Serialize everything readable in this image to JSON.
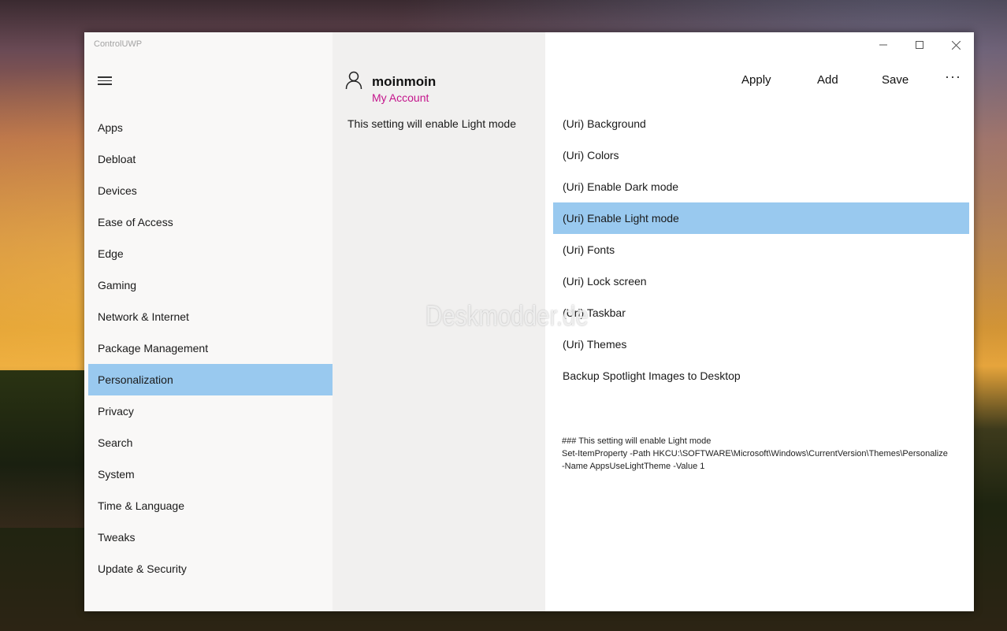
{
  "window": {
    "app_title": "ControlUWP",
    "minimize_icon": "minimize-icon",
    "maximize_icon": "maximize-icon",
    "close_icon": "close-icon"
  },
  "nav": {
    "menu_icon": "hamburger-menu-icon",
    "items": [
      {
        "label": "Apps"
      },
      {
        "label": "Debloat"
      },
      {
        "label": "Devices"
      },
      {
        "label": "Ease of Access"
      },
      {
        "label": "Edge"
      },
      {
        "label": "Gaming"
      },
      {
        "label": "Network & Internet"
      },
      {
        "label": "Package Management"
      },
      {
        "label": "Personalization",
        "selected": true
      },
      {
        "label": "Privacy"
      },
      {
        "label": "Search"
      },
      {
        "label": "System"
      },
      {
        "label": "Time & Language"
      },
      {
        "label": "Tweaks"
      },
      {
        "label": "Update & Security"
      }
    ]
  },
  "account": {
    "icon": "user-icon",
    "user_name": "moinmoin",
    "link_label": "My Account"
  },
  "description": "This setting will enable Light mode",
  "toolbar": {
    "apply_label": "Apply",
    "add_label": "Add",
    "save_label": "Save",
    "more_label": "···"
  },
  "settings": {
    "items": [
      {
        "label": "(Uri) Background"
      },
      {
        "label": "(Uri) Colors"
      },
      {
        "label": "(Uri) Enable Dark mode"
      },
      {
        "label": "(Uri) Enable Light mode",
        "selected": true
      },
      {
        "label": "(Uri) Fonts"
      },
      {
        "label": "(Uri) Lock screen"
      },
      {
        "label": "(Uri) Taskbar"
      },
      {
        "label": "(Uri) Themes"
      },
      {
        "label": "Backup Spotlight Images to Desktop"
      }
    ]
  },
  "script": {
    "line1": "### This setting will enable Light mode",
    "line2": "Set-ItemProperty -Path HKCU:\\SOFTWARE\\Microsoft\\Windows\\CurrentVersion\\Themes\\Personalize",
    "line3": "-Name AppsUseLightTheme -Value 1"
  },
  "watermark": "Deskmodder.de",
  "colors": {
    "selection": "#99c9ef",
    "account_link": "#c4158c"
  }
}
